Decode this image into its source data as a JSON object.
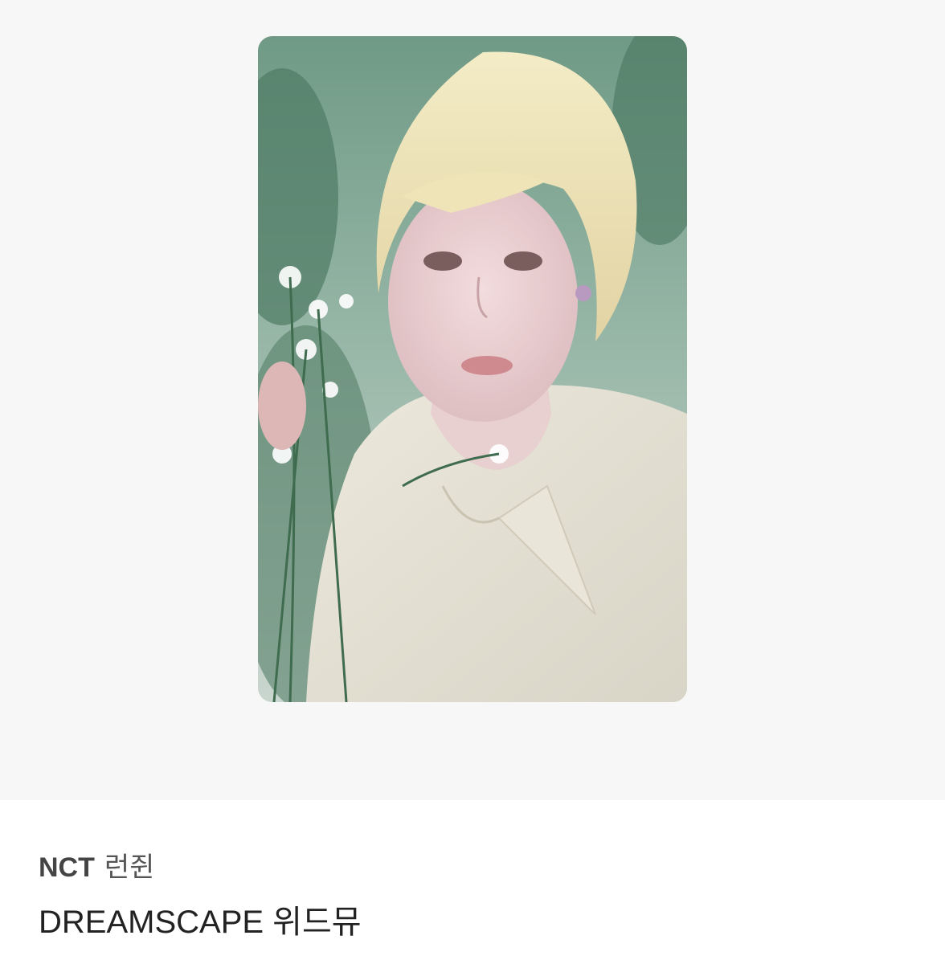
{
  "product": {
    "group": "NCT",
    "member": "런쥔",
    "title": "DREAMSCAPE 위드뮤"
  },
  "colors": {
    "image_background": "#f7f7f7",
    "info_background": "#ffffff",
    "text_primary": "#222222",
    "text_secondary": "#4a4a4a"
  },
  "photo": {
    "icon": "photocard-image"
  }
}
